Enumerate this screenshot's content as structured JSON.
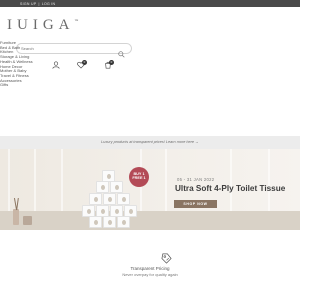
{
  "topbar": {
    "sign_up": "SIGN UP",
    "separator": "|",
    "login": "LOG IN",
    "background": "#4a4a4a"
  },
  "brand": {
    "name": "IUIGA",
    "trademark": "™"
  },
  "search": {
    "placeholder": "Search",
    "value": ""
  },
  "header_icons": [
    {
      "icon": "user-icon"
    },
    {
      "icon": "wishlist-icon",
      "count": "0"
    },
    {
      "icon": "cart-icon",
      "count": "0"
    }
  ],
  "categories": [
    "Furniture",
    "Bed & Bath",
    "Kitchen",
    "Storage & Living",
    "Health & Wellness",
    "Home Decor",
    "Mother & Baby",
    "Travel & Fitness",
    "Accessories",
    "Gifts"
  ],
  "notice": {
    "text": "Luxury products at transparent prices! Learn more here →"
  },
  "hero": {
    "badge_line1": "BUY 1",
    "badge_line2": "FREE 1",
    "date": "05 - 31 JAN 2022",
    "title": "Ultra Soft 4-Ply Toilet Tissue",
    "cta": "SHOP NOW",
    "badge_color": "#b34a56",
    "cta_color": "#8a7563"
  },
  "feature": {
    "icon": "price-tag-icon",
    "title": "Transparent Pricing",
    "subtitle": "Never overpay for quality again"
  }
}
